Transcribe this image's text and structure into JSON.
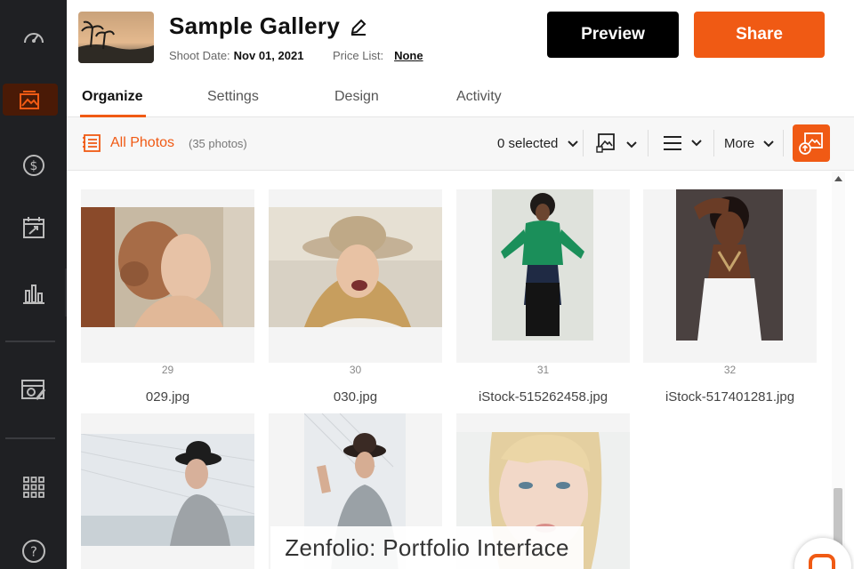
{
  "gallery": {
    "title": "Sample Gallery",
    "shoot_date_label": "Shoot Date:",
    "shoot_date": "Nov 01, 2021",
    "price_list_label": "Price List:",
    "price_list": "None"
  },
  "actions": {
    "preview": "Preview",
    "share": "Share"
  },
  "tabs": [
    {
      "label": "Organize",
      "active": true
    },
    {
      "label": "Settings"
    },
    {
      "label": "Design"
    },
    {
      "label": "Activity"
    }
  ],
  "toolbar": {
    "all_photos": "All Photos",
    "count": "(35 photos)",
    "selected": "0 selected",
    "more": "More"
  },
  "sidebar": {
    "items": [
      "dashboard-icon",
      "galleries-icon",
      "sales-icon",
      "calendar-icon",
      "stats-icon",
      "website-icon",
      "apps-icon",
      "help-icon"
    ]
  },
  "photos": [
    {
      "number": "29",
      "filename": "029.jpg"
    },
    {
      "number": "30",
      "filename": "030.jpg"
    },
    {
      "number": "31",
      "filename": "iStock-515262458.jpg"
    },
    {
      "number": "32",
      "filename": "iStock-517401281.jpg"
    },
    {
      "number": "",
      "filename": ""
    },
    {
      "number": "",
      "filename": ""
    },
    {
      "number": "",
      "filename": ""
    }
  ],
  "caption": "Zenfolio: Portfolio Interface",
  "colors": {
    "accent": "#f05a14",
    "sidebar": "#1f2023"
  }
}
